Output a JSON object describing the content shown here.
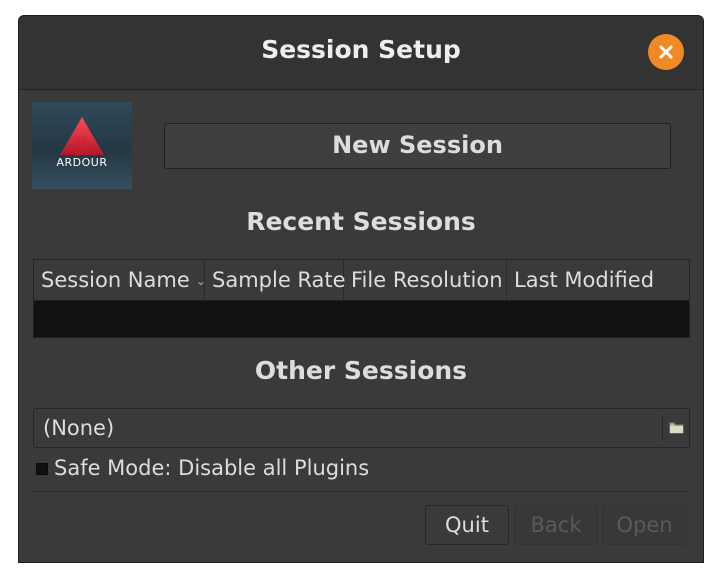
{
  "window": {
    "title": "Session Setup",
    "close_icon": "close-icon"
  },
  "logo": {
    "text": "ARDOUR",
    "icon": "ardour-logo"
  },
  "new_session": {
    "label": "New Session"
  },
  "recent": {
    "heading": "Recent Sessions",
    "columns": [
      {
        "label": "Session Name",
        "sort_icon": "chevron-down-icon"
      },
      {
        "label": "Sample Rate"
      },
      {
        "label": "File Resolution"
      },
      {
        "label": "Last Modified"
      }
    ],
    "rows": []
  },
  "other": {
    "heading": "Other Sessions",
    "file_chooser_value": "(None)",
    "file_chooser_icon": "folder-icon"
  },
  "safe_mode": {
    "label": "Safe Mode: Disable all Plugins",
    "checked": false
  },
  "buttons": {
    "quit": "Quit",
    "back": "Back",
    "open": "Open"
  },
  "colors": {
    "accent_close": "#f08a24",
    "window_bg": "#3a3a3a",
    "text": "#dddddd",
    "disabled_text": "#5a5a5a"
  }
}
